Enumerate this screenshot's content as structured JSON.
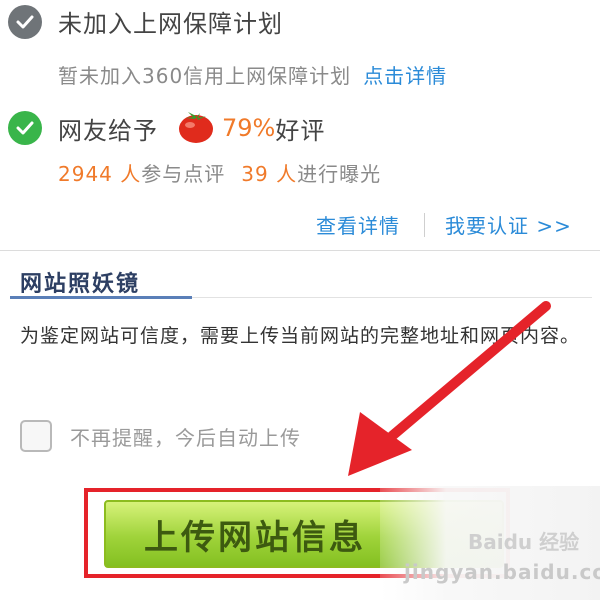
{
  "status": {
    "plan_title": "未加入上网保障计划",
    "plan_desc": "暂未加入360信用上网保障计划",
    "plan_link": "点击详情",
    "review_title": "网友给予",
    "review_percent": "79%",
    "review_good": "好评",
    "participants_count": "2944 人",
    "participants_text": "参与点评",
    "exposure_count": "39 人",
    "exposure_text": "进行曝光",
    "view_details": "查看详情",
    "certify": "我要认证 >>"
  },
  "panel": {
    "title": "网站照妖镜",
    "description": "为鉴定网站可信度，需要上传当前网站的完整地址和网页内容。",
    "checkbox_label": "不再提醒，今后自动上传",
    "upload_button": "上传网站信息",
    "checkbox_checked": false
  },
  "watermark": {
    "brand": "Baidu 经验",
    "site": "jingyan.baidu.com"
  },
  "colors": {
    "accent_link": "#2b8bd8",
    "orange": "#f07a2a",
    "annotation_red": "#e5232a",
    "button_green": "#9fd33a"
  },
  "icons": [
    "check-gray-icon",
    "check-green-icon",
    "tomato-icon",
    "red-arrow-annotation"
  ]
}
